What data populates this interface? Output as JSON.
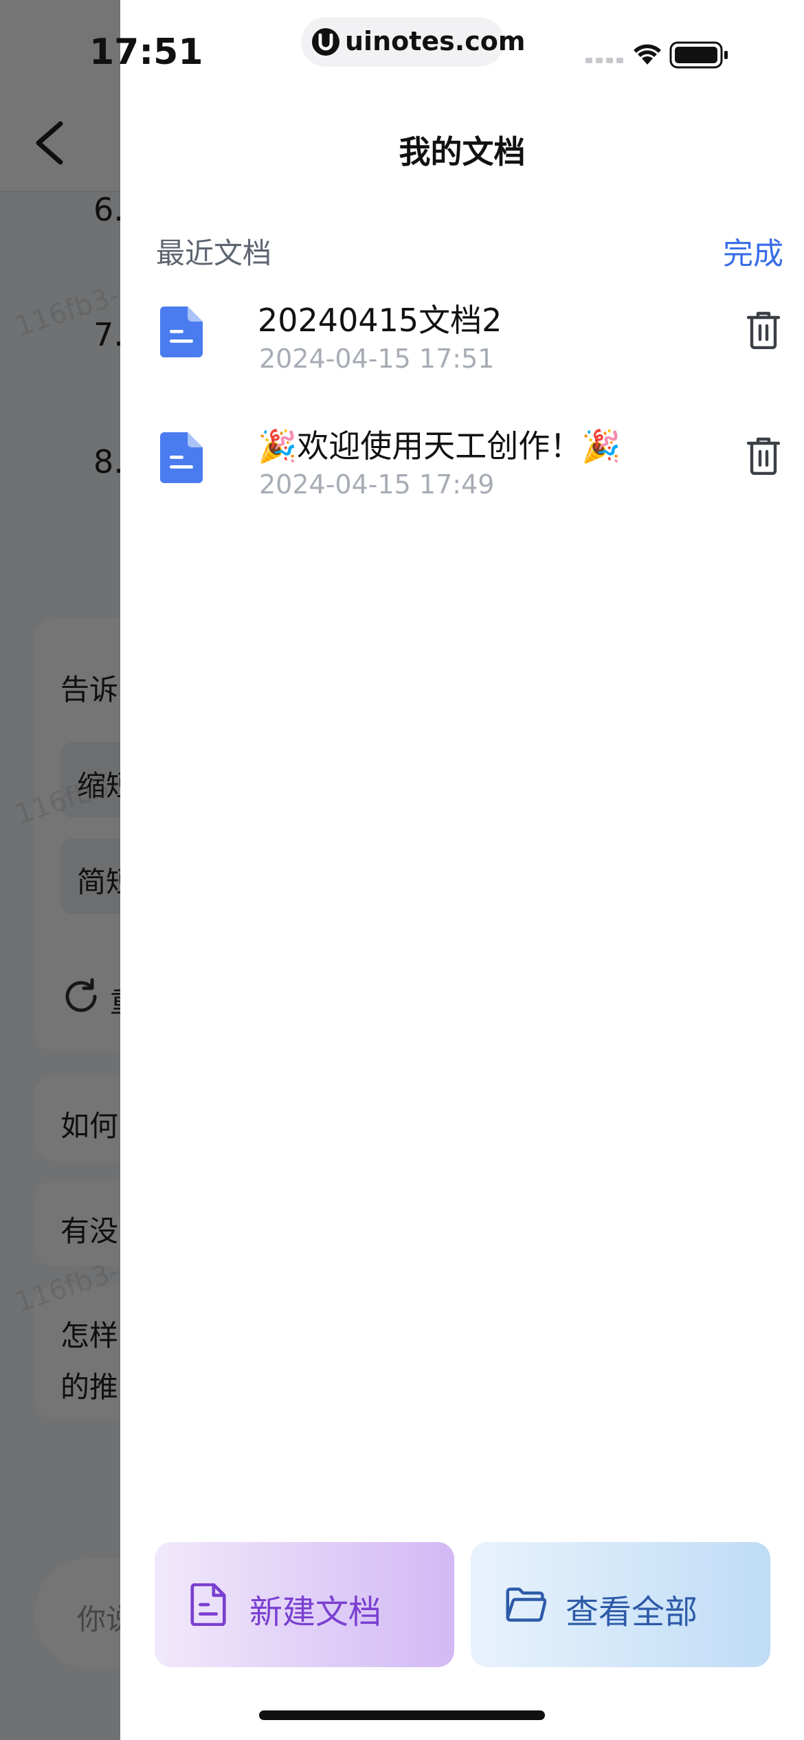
{
  "status_bar": {
    "time": "17:51",
    "url": "uinotes.com"
  },
  "background": {
    "list_numbers": [
      "6.",
      "7.",
      "8."
    ],
    "prompt_label": "告诉",
    "chips": [
      "缩短",
      "简短"
    ],
    "regenerate_label": "重",
    "suggestions": [
      "如何",
      "有没",
      "怎样",
      "的推"
    ],
    "input_placeholder": "你说"
  },
  "drawer": {
    "title": "我的文档",
    "section_label": "最近文档",
    "done_label": "完成",
    "documents": [
      {
        "title": "20240415文档2",
        "time": "2024-04-15 17:51"
      },
      {
        "title": "🎉欢迎使用天工创作！🎉",
        "time": "2024-04-15 17:49"
      }
    ],
    "new_doc_label": "新建文档",
    "view_all_label": "查看全部"
  },
  "colors": {
    "accent": "#3a6ee8",
    "doc_icon": "#4a7cf0",
    "new_doc_text": "#7a3fd0",
    "view_all_text": "#2d5ba8"
  },
  "icons": {
    "doc": "document-icon",
    "trash": "trash-icon",
    "new_doc": "file-text-icon",
    "view_all": "folder-icon",
    "back": "chevron-left-icon"
  }
}
